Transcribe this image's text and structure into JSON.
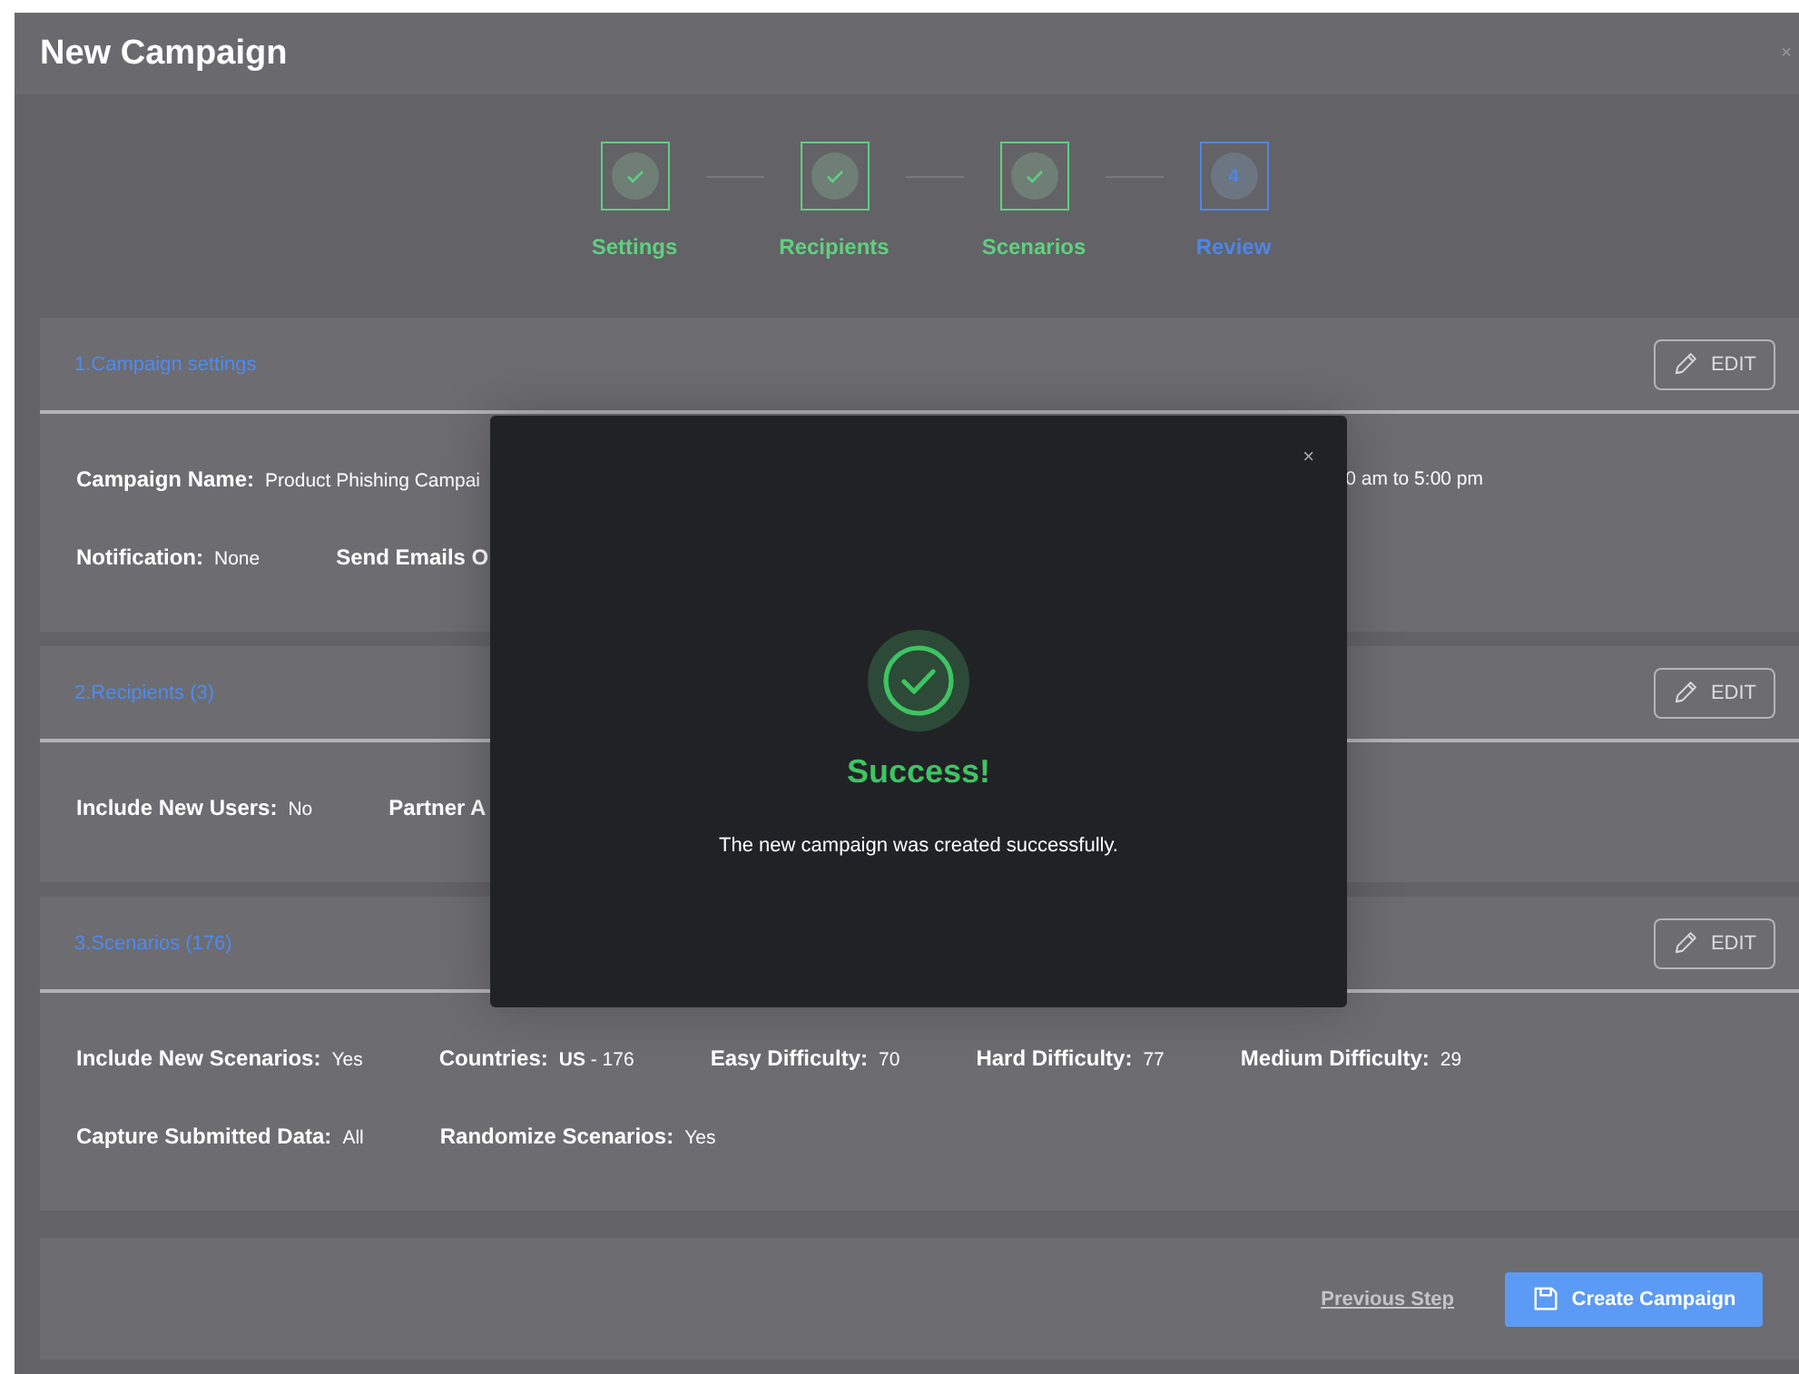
{
  "window": {
    "title": "New Campaign",
    "close": "×"
  },
  "steps": [
    {
      "label": "Settings",
      "completed": true,
      "selected": false
    },
    {
      "label": "Recipients",
      "completed": true,
      "selected": false
    },
    {
      "label": "Scenarios",
      "completed": true,
      "selected": false
    },
    {
      "label": "Review",
      "completed": false,
      "selected": true,
      "number": "4"
    }
  ],
  "sections": [
    {
      "title": "1.Campaign settings",
      "edit": "EDIT",
      "lines": [
        {
          "fields": [
            {
              "label": "Campaign Name:",
              "value": "Product Phishing Campai"
            },
            {
              "value": "0 am to 5:00 pm"
            }
          ]
        },
        {
          "fields": [
            {
              "label": "Notification:",
              "value": "None"
            },
            {
              "label": "Send Emails O"
            }
          ]
        }
      ]
    },
    {
      "title": "2.Recipients (3)",
      "edit": "EDIT",
      "lines": [
        {
          "fields": [
            {
              "label": "Include New Users:",
              "value": "No"
            },
            {
              "label": "Partner A"
            }
          ]
        }
      ]
    },
    {
      "title": "3.Scenarios (176)",
      "edit": "EDIT",
      "lines": [
        {
          "fields": [
            {
              "label": "Include New Scenarios:",
              "value": "Yes"
            },
            {
              "label": "Countries:",
              "value": "**US** - 176"
            },
            {
              "label": "Easy Difficulty:",
              "value": "70"
            },
            {
              "label": "Hard Difficulty:",
              "value": "77"
            },
            {
              "label": "Medium Difficulty:",
              "value": "29"
            }
          ]
        },
        {
          "fields": [
            {
              "label": "Capture Submitted Data:",
              "value": "All"
            },
            {
              "label": "Randomize Scenarios:",
              "value": "Yes"
            }
          ]
        }
      ]
    }
  ],
  "footer": {
    "previous": "Previous Step",
    "create": "Create Campaign"
  },
  "modal": {
    "close": "×",
    "title": "Success!",
    "message": "The new campaign was created successfully."
  }
}
